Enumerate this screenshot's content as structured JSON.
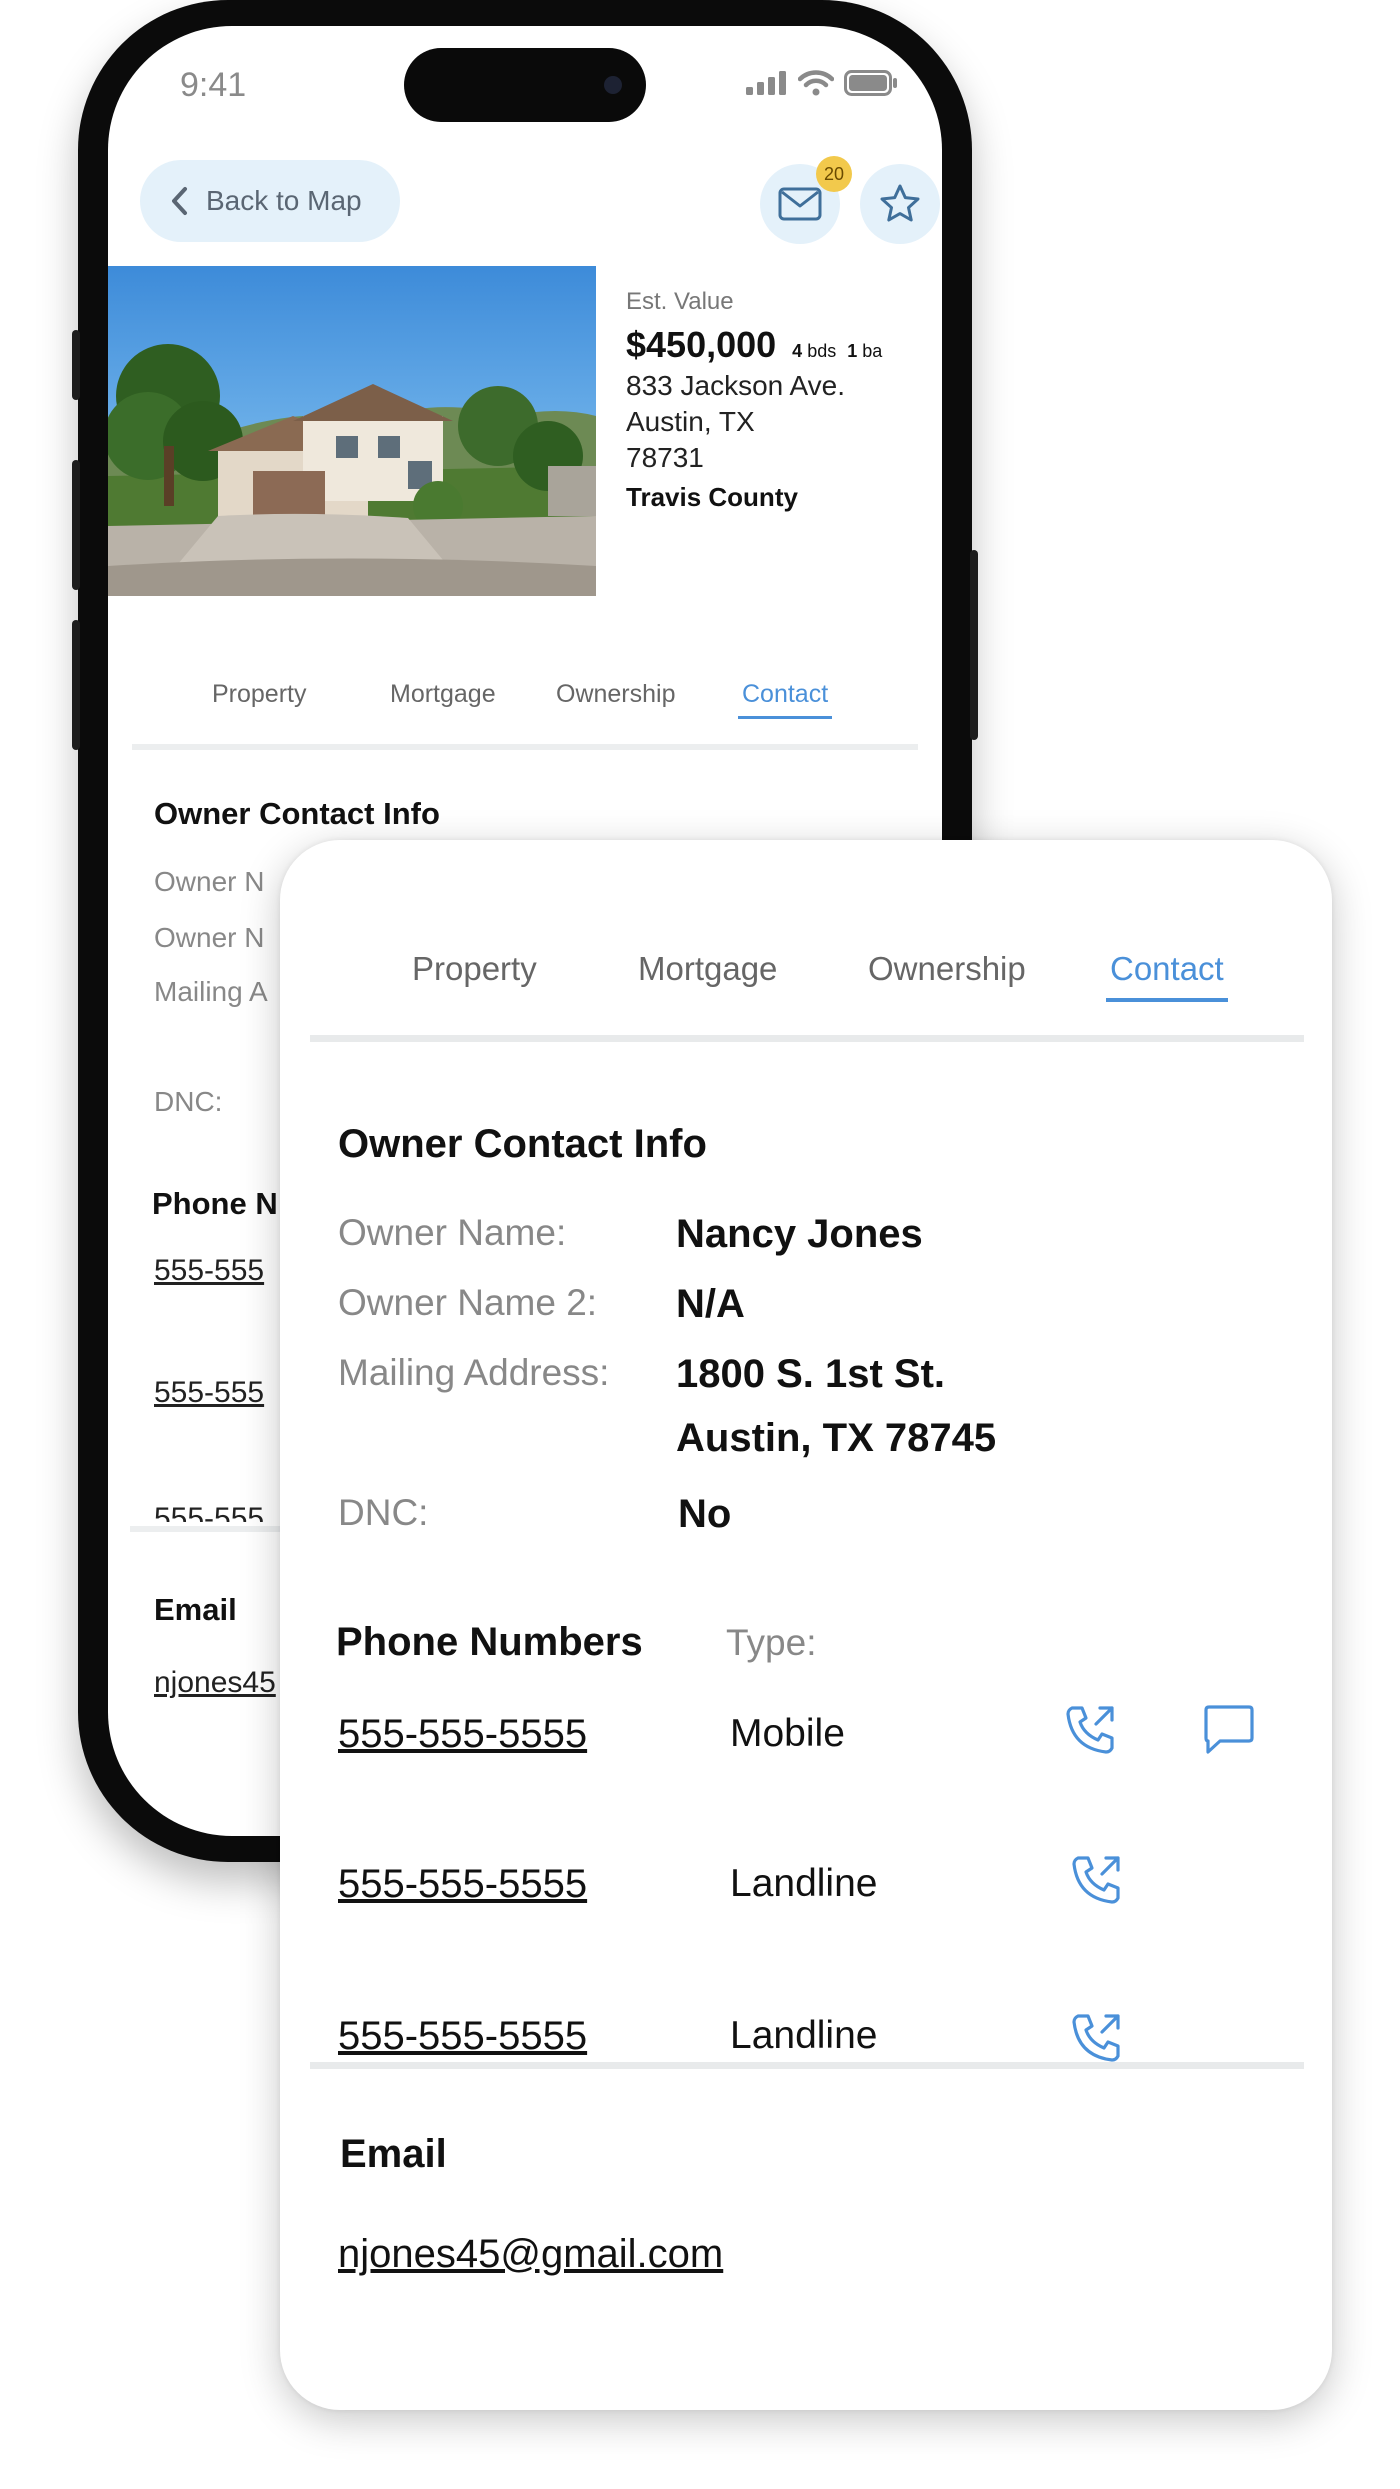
{
  "status_bar": {
    "time": "9:41"
  },
  "header": {
    "back_label": "Back to Map",
    "notification_count": "20"
  },
  "property": {
    "value_label": "Est. Value",
    "price": "$450,000",
    "beds_count": "4",
    "beds_unit": "bds",
    "baths_count": "1",
    "baths_unit": "ba",
    "address_line1": "833 Jackson Ave.",
    "address_line2": "Austin, TX",
    "zip": "78731",
    "county": "Travis County"
  },
  "tabs": [
    {
      "label": "Property",
      "active": false
    },
    {
      "label": "Mortgage",
      "active": false
    },
    {
      "label": "Ownership",
      "active": false
    },
    {
      "label": "Contact",
      "active": true
    }
  ],
  "owner_section": {
    "title": "Owner Contact Info",
    "owner_name_label": "Owner Name:",
    "owner_name": "Nancy Jones",
    "owner_name2_label": "Owner Name 2:",
    "owner_name2": "N/A",
    "mailing_label": "Mailing Address:",
    "mailing_line1": "1800 S. 1st St.",
    "mailing_line2": "Austin, TX 78745",
    "dnc_label": "DNC:",
    "dnc_value": "No"
  },
  "phone_section": {
    "title": "Phone Numbers",
    "type_header": "Type:",
    "numbers": [
      {
        "number": "555-555-5555",
        "type": "Mobile",
        "can_text": true
      },
      {
        "number": "555-555-5555",
        "type": "Landline",
        "can_text": false
      },
      {
        "number": "555-555-5555",
        "type": "Landline",
        "can_text": false
      }
    ]
  },
  "email_section": {
    "title": "Email",
    "email": "njones45@gmail.com"
  },
  "phone_preview": {
    "owner_name_label_partial": "Owner N",
    "owner_name2_label_partial": "Owner N",
    "mailing_label_partial": "Mailing A",
    "phone_title_partial": "Phone N",
    "number_partial": "555-555",
    "email_partial": "njones45"
  },
  "colors": {
    "accent": "#4a90d9",
    "badge": "#f2c94c",
    "chip_bg": "#e4f1fa"
  }
}
